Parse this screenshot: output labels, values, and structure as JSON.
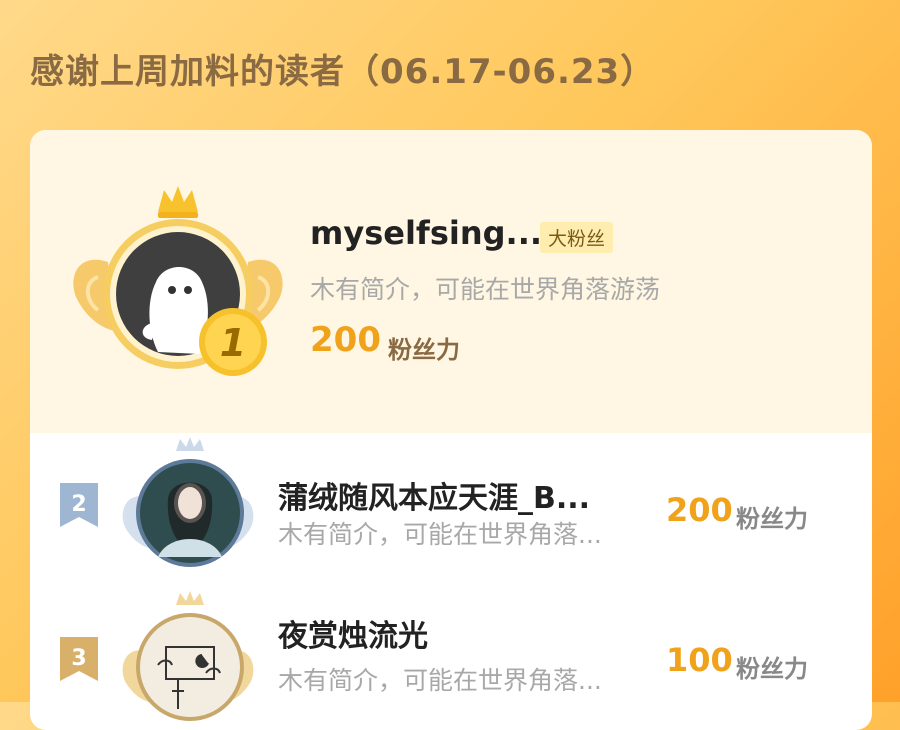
{
  "page": {
    "title": "感谢上周加料的读者（06.17-06.23）"
  },
  "top_reader": {
    "rank": "1",
    "name": "myselfsing...",
    "tag": "大粉丝",
    "bio": "木有简介，可能在世界角落游荡",
    "score": "200",
    "unit": "粉丝力"
  },
  "readers": [
    {
      "rank": "2",
      "name": "蒲绒随风本应天涯_B...",
      "bio": "木有简介，可能在世界角落...",
      "score": "200",
      "unit": "粉丝力"
    },
    {
      "rank": "3",
      "name": "夜赏烛流光",
      "bio": "木有简介，可能在世界角落...",
      "score": "100",
      "unit": "粉丝力"
    }
  ],
  "colors": {
    "accent": "#f0a21a",
    "title": "#8a6a43",
    "silver_flag": "#9fb6d3",
    "bronze_flag": "#d8b06a"
  },
  "icons": {
    "crown": "crown-icon",
    "wings": "wings-icon",
    "default_avatar": "ghost-avatar-icon"
  }
}
